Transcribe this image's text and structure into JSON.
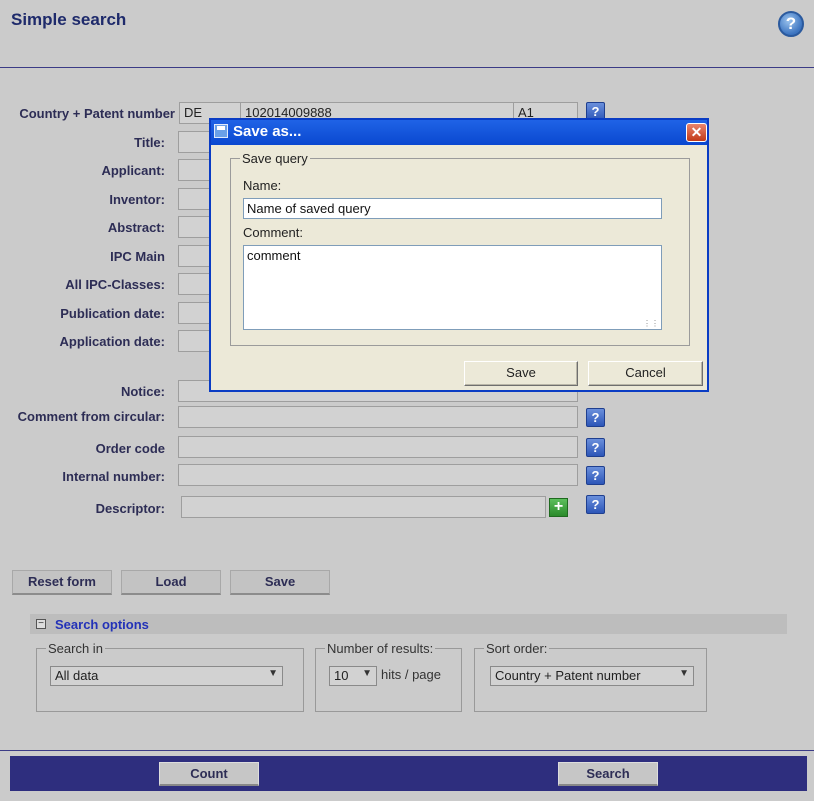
{
  "page": {
    "title": "Simple search",
    "help_icon": "?"
  },
  "form": {
    "country_patent": {
      "label": "Country + Patent number",
      "country": "DE",
      "number": "102014009888",
      "kind": "A1"
    },
    "labels": {
      "title": "Title:",
      "applicant": "Applicant:",
      "inventor": "Inventor:",
      "abstract": "Abstract:",
      "ipc_main": "IPC Main",
      "all_ipc": "All IPC-Classes:",
      "publication_date": "Publication date:",
      "application_date": "Application date:",
      "notice": "Notice:",
      "comment_circular": "Comment from circular:",
      "order_code": "Order code",
      "internal_number": "Internal number:",
      "descriptor": "Descriptor:"
    },
    "help_glyph": "?",
    "plus_glyph": "+"
  },
  "form_buttons": {
    "reset": "Reset form",
    "load": "Load",
    "save": "Save"
  },
  "search_options": {
    "title": "Search options",
    "toggle_glyph": "−",
    "search_in": {
      "legend": "Search in",
      "value": "All data"
    },
    "number_results": {
      "legend": "Number of results:",
      "value": "10",
      "suffix": "hits / page"
    },
    "sort_order": {
      "legend": "Sort order:",
      "value": "Country + Patent number"
    }
  },
  "footer": {
    "count": "Count",
    "search": "Search"
  },
  "dialog": {
    "title": "Save as...",
    "close_glyph": "✕",
    "fieldset_legend": "Save query",
    "name_label": "Name:",
    "name_value": "Name of saved query",
    "comment_label": "Comment:",
    "comment_value": "comment",
    "save": "Save",
    "cancel": "Cancel"
  },
  "colors": {
    "background": "#cbcbcb",
    "navy": "#2e2e7e",
    "dialog_title": "#0a48d0",
    "link_blue": "#2332b8"
  }
}
